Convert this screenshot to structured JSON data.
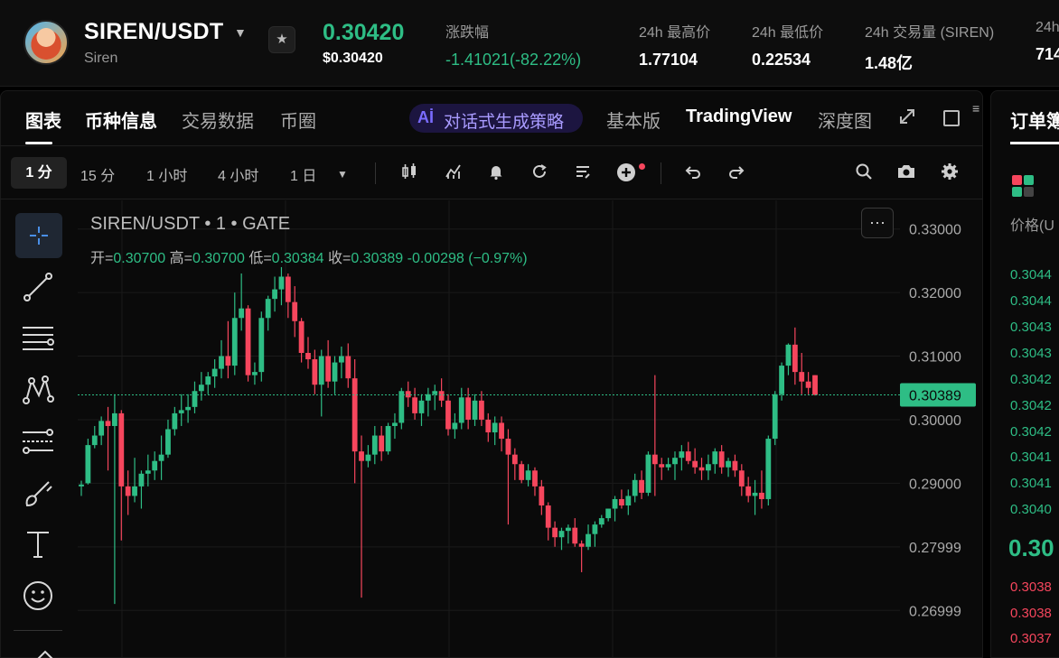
{
  "header": {
    "pair": "SIREN/USDT",
    "subtitle": "Siren",
    "last_price": "0.30420",
    "last_price_usd": "$0.30420",
    "stats": [
      {
        "label": "涨跌幅",
        "value": "-1.41021(-82.22%)"
      },
      {
        "label": "24h 最高价",
        "value": "1.77104"
      },
      {
        "label": "24h 最低价",
        "value": "0.22534"
      },
      {
        "label": "24h 交易量 (SIREN)",
        "value": "1.48亿"
      },
      {
        "label": "24h",
        "value": "714"
      }
    ]
  },
  "tabs": {
    "chart": "图表",
    "coin_info": "币种信息",
    "trade_data": "交易数据",
    "circle": "币圈",
    "ai_label": "对话式生成策略",
    "ai_icon": "Aİ",
    "basic": "基本版",
    "tradingview": "TradingView",
    "depth": "深度图"
  },
  "toolbar": {
    "timeframes": [
      "1 分",
      "15 分",
      "1 小时",
      "4 小时",
      "1 日"
    ]
  },
  "chart_info": {
    "title": "SIREN/USDT • 1 • GATE",
    "open_label": "开=",
    "open": "0.30700",
    "high_label": "高=",
    "high": "0.30700",
    "low_label": "低=",
    "low": "0.30384",
    "close_label": "收=",
    "close": "0.30389",
    "change": "-0.00298 (−0.97%)",
    "current_price_tag": "0.30389",
    "more": "···"
  },
  "order_book": {
    "title": "订单簿",
    "price_header": "价格(U",
    "asks": [
      "0.3044",
      "0.3044",
      "0.3043",
      "0.3043",
      "0.3042",
      "0.3042",
      "0.3042",
      "0.3041",
      "0.3041",
      "0.3040"
    ],
    "mid": "0.30",
    "bids": [
      "0.3038",
      "0.3038",
      "0.3037"
    ]
  },
  "colors": {
    "up": "#2ebd85",
    "down": "#f6465d",
    "background": "#0a0a0a",
    "grid": "#1a1a1a",
    "accent": "#4a8fe6"
  },
  "chart_data": {
    "type": "candlestick",
    "title": "SIREN/USDT • 1 • GATE",
    "y_ticks": [
      "0.33000",
      "0.32000",
      "0.31000",
      "0.30000",
      "0.29000",
      "0.27999",
      "0.26999"
    ],
    "ylim": [
      0.2625,
      0.3345
    ],
    "current_price": 0.30389,
    "candles": [
      [
        0.2895,
        0.2904,
        0.288,
        0.2898
      ],
      [
        0.29,
        0.297,
        0.2898,
        0.296
      ],
      [
        0.296,
        0.299,
        0.2955,
        0.2975
      ],
      [
        0.2975,
        0.3005,
        0.296,
        0.2998
      ],
      [
        0.2998,
        0.302,
        0.292,
        0.299
      ],
      [
        0.299,
        0.304,
        0.271,
        0.301
      ],
      [
        0.301,
        0.3015,
        0.281,
        0.2895
      ],
      [
        0.2895,
        0.292,
        0.285,
        0.288
      ],
      [
        0.288,
        0.294,
        0.287,
        0.2895
      ],
      [
        0.2895,
        0.292,
        0.286,
        0.2915
      ],
      [
        0.2915,
        0.2945,
        0.2895,
        0.292
      ],
      [
        0.292,
        0.295,
        0.2905,
        0.2935
      ],
      [
        0.2935,
        0.2975,
        0.2905,
        0.2945
      ],
      [
        0.2945,
        0.3,
        0.294,
        0.2985
      ],
      [
        0.2985,
        0.302,
        0.2975,
        0.301
      ],
      [
        0.301,
        0.304,
        0.299,
        0.3015
      ],
      [
        0.3015,
        0.304,
        0.2995,
        0.302
      ],
      [
        0.302,
        0.306,
        0.301,
        0.3045
      ],
      [
        0.3045,
        0.3075,
        0.303,
        0.3055
      ],
      [
        0.3055,
        0.3075,
        0.304,
        0.3068
      ],
      [
        0.3068,
        0.3095,
        0.305,
        0.308
      ],
      [
        0.308,
        0.3125,
        0.3065,
        0.31
      ],
      [
        0.31,
        0.3155,
        0.3065,
        0.3085
      ],
      [
        0.3085,
        0.32,
        0.307,
        0.316
      ],
      [
        0.316,
        0.323,
        0.314,
        0.3175
      ],
      [
        0.3175,
        0.318,
        0.306,
        0.307
      ],
      [
        0.307,
        0.309,
        0.3055,
        0.3075
      ],
      [
        0.3075,
        0.317,
        0.306,
        0.316
      ],
      [
        0.316,
        0.3195,
        0.314,
        0.319
      ],
      [
        0.319,
        0.3225,
        0.317,
        0.3205
      ],
      [
        0.3205,
        0.324,
        0.318,
        0.3225
      ],
      [
        0.3225,
        0.323,
        0.316,
        0.3185
      ],
      [
        0.3185,
        0.321,
        0.313,
        0.3155
      ],
      [
        0.3155,
        0.316,
        0.309,
        0.3105
      ],
      [
        0.3105,
        0.313,
        0.308,
        0.3095
      ],
      [
        0.3095,
        0.311,
        0.304,
        0.3055
      ],
      [
        0.3055,
        0.311,
        0.3005,
        0.31
      ],
      [
        0.31,
        0.3125,
        0.305,
        0.306
      ],
      [
        0.306,
        0.31,
        0.304,
        0.309
      ],
      [
        0.309,
        0.3115,
        0.3065,
        0.31
      ],
      [
        0.31,
        0.312,
        0.305,
        0.3065
      ],
      [
        0.3065,
        0.3095,
        0.29,
        0.295
      ],
      [
        0.295,
        0.2975,
        0.272,
        0.2935
      ],
      [
        0.2935,
        0.296,
        0.2925,
        0.2945
      ],
      [
        0.2945,
        0.299,
        0.293,
        0.2975
      ],
      [
        0.2975,
        0.299,
        0.2935,
        0.295
      ],
      [
        0.295,
        0.2995,
        0.2945,
        0.299
      ],
      [
        0.299,
        0.301,
        0.297,
        0.2995
      ],
      [
        0.2995,
        0.305,
        0.2985,
        0.3045
      ],
      [
        0.3045,
        0.306,
        0.302,
        0.3035
      ],
      [
        0.3035,
        0.305,
        0.3,
        0.301
      ],
      [
        0.301,
        0.304,
        0.299,
        0.303
      ],
      [
        0.303,
        0.305,
        0.3005,
        0.304
      ],
      [
        0.304,
        0.3055,
        0.3015,
        0.3045
      ],
      [
        0.3045,
        0.3065,
        0.302,
        0.303
      ],
      [
        0.303,
        0.304,
        0.2975,
        0.2985
      ],
      [
        0.2985,
        0.301,
        0.297,
        0.2995
      ],
      [
        0.2995,
        0.305,
        0.2985,
        0.3035
      ],
      [
        0.3035,
        0.305,
        0.2985,
        0.3
      ],
      [
        0.3,
        0.304,
        0.299,
        0.303
      ],
      [
        0.303,
        0.3045,
        0.299,
        0.3
      ],
      [
        0.3,
        0.301,
        0.2965,
        0.298
      ],
      [
        0.298,
        0.3005,
        0.296,
        0.2995
      ],
      [
        0.2995,
        0.3005,
        0.295,
        0.297
      ],
      [
        0.297,
        0.2985,
        0.2835,
        0.2945
      ],
      [
        0.2945,
        0.2955,
        0.2905,
        0.293
      ],
      [
        0.293,
        0.2935,
        0.29,
        0.2905
      ],
      [
        0.2905,
        0.293,
        0.2895,
        0.292
      ],
      [
        0.292,
        0.2925,
        0.288,
        0.2895
      ],
      [
        0.2895,
        0.2905,
        0.285,
        0.2865
      ],
      [
        0.2865,
        0.287,
        0.281,
        0.283
      ],
      [
        0.283,
        0.284,
        0.28,
        0.2815
      ],
      [
        0.2815,
        0.283,
        0.2795,
        0.2825
      ],
      [
        0.2825,
        0.2835,
        0.2805,
        0.283
      ],
      [
        0.283,
        0.2845,
        0.28,
        0.2805
      ],
      [
        0.2805,
        0.281,
        0.276,
        0.28
      ],
      [
        0.28,
        0.2835,
        0.2795,
        0.282
      ],
      [
        0.282,
        0.284,
        0.28,
        0.2835
      ],
      [
        0.2835,
        0.285,
        0.283,
        0.2845
      ],
      [
        0.2845,
        0.286,
        0.284,
        0.286
      ],
      [
        0.286,
        0.288,
        0.284,
        0.2875
      ],
      [
        0.2875,
        0.289,
        0.286,
        0.2865
      ],
      [
        0.2865,
        0.289,
        0.285,
        0.288
      ],
      [
        0.288,
        0.2915,
        0.287,
        0.2905
      ],
      [
        0.2905,
        0.292,
        0.2875,
        0.2885
      ],
      [
        0.2885,
        0.295,
        0.288,
        0.2945
      ],
      [
        0.2945,
        0.307,
        0.288,
        0.293
      ],
      [
        0.293,
        0.294,
        0.2905,
        0.2925
      ],
      [
        0.2925,
        0.294,
        0.292,
        0.293
      ],
      [
        0.293,
        0.295,
        0.2905,
        0.294
      ],
      [
        0.294,
        0.296,
        0.292,
        0.295
      ],
      [
        0.295,
        0.2965,
        0.293,
        0.2935
      ],
      [
        0.2935,
        0.2955,
        0.2915,
        0.2925
      ],
      [
        0.2925,
        0.294,
        0.2905,
        0.292
      ],
      [
        0.292,
        0.2945,
        0.2905,
        0.293
      ],
      [
        0.293,
        0.2955,
        0.2915,
        0.295
      ],
      [
        0.295,
        0.296,
        0.2915,
        0.2925
      ],
      [
        0.2925,
        0.294,
        0.291,
        0.2935
      ],
      [
        0.2935,
        0.2945,
        0.291,
        0.292
      ],
      [
        0.292,
        0.293,
        0.288,
        0.2895
      ],
      [
        0.2895,
        0.291,
        0.287,
        0.288
      ],
      [
        0.288,
        0.2905,
        0.285,
        0.2885
      ],
      [
        0.2885,
        0.292,
        0.286,
        0.2875
      ],
      [
        0.2875,
        0.2975,
        0.2865,
        0.297
      ],
      [
        0.297,
        0.3045,
        0.296,
        0.304
      ],
      [
        0.304,
        0.309,
        0.303,
        0.3085
      ],
      [
        0.3085,
        0.312,
        0.307,
        0.3118
      ],
      [
        0.3118,
        0.3145,
        0.3055,
        0.3075
      ],
      [
        0.3075,
        0.3105,
        0.304,
        0.306
      ],
      [
        0.306,
        0.3075,
        0.304,
        0.305
      ],
      [
        0.307,
        0.307,
        0.3038,
        0.3039
      ]
    ]
  }
}
